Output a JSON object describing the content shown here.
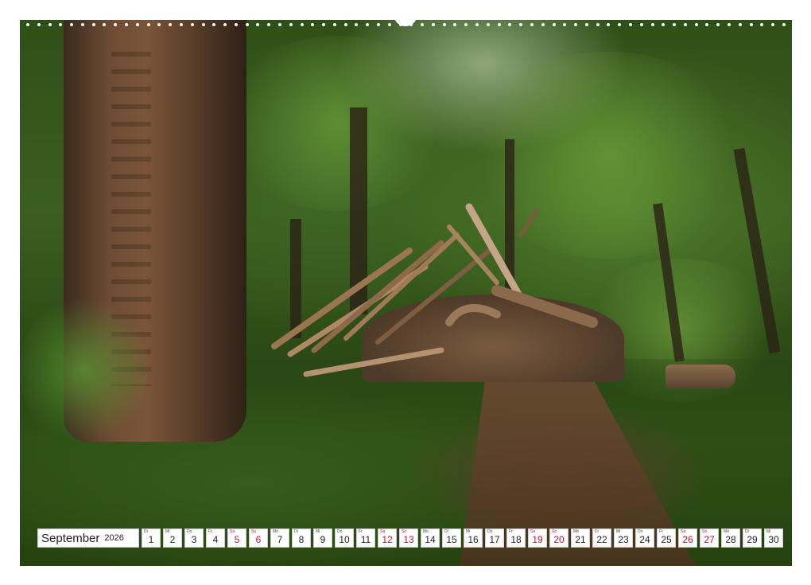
{
  "calendar": {
    "month": "September",
    "year": "2026",
    "weekend_color": "#c8102e",
    "days": [
      {
        "dow": "Di",
        "num": "1",
        "weekend": false
      },
      {
        "dow": "Mi",
        "num": "2",
        "weekend": false
      },
      {
        "dow": "Do",
        "num": "3",
        "weekend": false
      },
      {
        "dow": "Fr",
        "num": "4",
        "weekend": false
      },
      {
        "dow": "Sa",
        "num": "5",
        "weekend": true
      },
      {
        "dow": "So",
        "num": "6",
        "weekend": true
      },
      {
        "dow": "Mo",
        "num": "7",
        "weekend": false
      },
      {
        "dow": "Di",
        "num": "8",
        "weekend": false
      },
      {
        "dow": "Mi",
        "num": "9",
        "weekend": false
      },
      {
        "dow": "Do",
        "num": "10",
        "weekend": false
      },
      {
        "dow": "Fr",
        "num": "11",
        "weekend": false
      },
      {
        "dow": "Sa",
        "num": "12",
        "weekend": true
      },
      {
        "dow": "So",
        "num": "13",
        "weekend": true
      },
      {
        "dow": "Mo",
        "num": "14",
        "weekend": false
      },
      {
        "dow": "Di",
        "num": "15",
        "weekend": false
      },
      {
        "dow": "Mi",
        "num": "16",
        "weekend": false
      },
      {
        "dow": "Do",
        "num": "17",
        "weekend": false
      },
      {
        "dow": "Fr",
        "num": "18",
        "weekend": false
      },
      {
        "dow": "Sa",
        "num": "19",
        "weekend": true
      },
      {
        "dow": "So",
        "num": "20",
        "weekend": true
      },
      {
        "dow": "Mo",
        "num": "21",
        "weekend": false
      },
      {
        "dow": "Di",
        "num": "22",
        "weekend": false
      },
      {
        "dow": "Mi",
        "num": "23",
        "weekend": false
      },
      {
        "dow": "Do",
        "num": "24",
        "weekend": false
      },
      {
        "dow": "Fr",
        "num": "25",
        "weekend": false
      },
      {
        "dow": "Sa",
        "num": "26",
        "weekend": true
      },
      {
        "dow": "So",
        "num": "27",
        "weekend": true
      },
      {
        "dow": "Mo",
        "num": "28",
        "weekend": false
      },
      {
        "dow": "Di",
        "num": "29",
        "weekend": false
      },
      {
        "dow": "Mi",
        "num": "30",
        "weekend": false
      }
    ]
  }
}
